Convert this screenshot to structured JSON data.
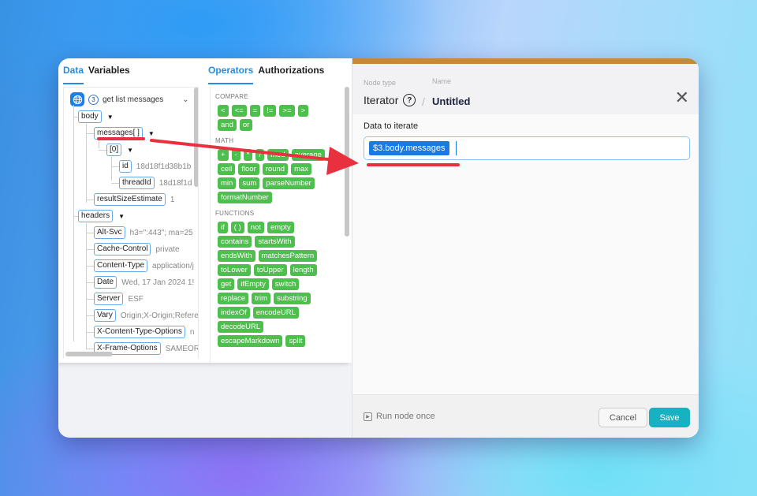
{
  "data_panel": {
    "tabs": [
      {
        "label": "Data",
        "active": true
      },
      {
        "label": "Variables",
        "active": false
      }
    ],
    "root": {
      "icon": "globe-icon",
      "step": "3",
      "label": "get list messages"
    },
    "tree": [
      {
        "key": "body",
        "value": "",
        "expandable": true
      },
      {
        "key": "messages[ ]",
        "value": "",
        "expandable": true
      },
      {
        "key": "[0]",
        "value": "",
        "expandable": true
      },
      {
        "key": "id",
        "value": "18d18f1d38b1b"
      },
      {
        "key": "threadId",
        "value": "18d18f1d"
      },
      {
        "key": "resultSizeEstimate",
        "value": "1"
      },
      {
        "key": "headers",
        "value": "",
        "expandable": true
      },
      {
        "key": "Alt-Svc",
        "value": "h3=\":443\"; ma=25"
      },
      {
        "key": "Cache-Control",
        "value": "private"
      },
      {
        "key": "Content-Type",
        "value": "application/j"
      },
      {
        "key": "Date",
        "value": "Wed, 17 Jan 2024 1!"
      },
      {
        "key": "Server",
        "value": "ESF"
      },
      {
        "key": "Vary",
        "value": "Origin;X-Origin;Refere"
      },
      {
        "key": "X-Content-Type-Options",
        "value": "n"
      },
      {
        "key": "X-Frame-Options",
        "value": "SAMEOR"
      }
    ]
  },
  "ops_panel": {
    "tabs": [
      {
        "label": "Operators",
        "active": true
      },
      {
        "label": "Authorizations",
        "active": false
      }
    ],
    "sections": [
      {
        "title": "COMPARE",
        "items": [
          "<",
          "<=",
          "=",
          "!=",
          ">=",
          ">",
          "and",
          "or"
        ]
      },
      {
        "title": "MATH",
        "items": [
          "+",
          "-",
          "*",
          "/",
          "mod",
          "average",
          "ceil",
          "floor",
          "round",
          "max",
          "min",
          "sum",
          "parseNumber",
          "formatNumber"
        ]
      },
      {
        "title": "FUNCTIONS",
        "items": [
          "if",
          "( )",
          "not",
          "empty",
          "contains",
          "startsWith",
          "endsWith",
          "matchesPattern",
          "toLower",
          "toUpper",
          "length",
          "get",
          "ifEmpty",
          "switch",
          "replace",
          "trim",
          "substring",
          "indexOf",
          "encodeURL",
          "decodeURL",
          "escapeMarkdown",
          "split"
        ]
      }
    ]
  },
  "dialog": {
    "accent_color": "#c28a3a",
    "node_type_label": "Node type",
    "node_type": "Iterator",
    "help_glyph": "?",
    "separator": "/",
    "name_label": "Name",
    "name": "Untitled",
    "close_glyph": "✕",
    "field_label": "Data to iterate",
    "field_token": "$3.body.messages",
    "run_label": "Run node once",
    "cancel_label": "Cancel",
    "save_label": "Save",
    "save_color": "#18b1c2"
  }
}
